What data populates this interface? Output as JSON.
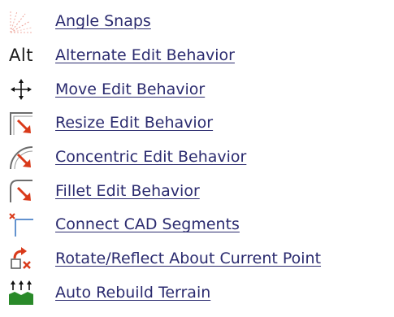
{
  "colors": {
    "link": "#2b2b6f",
    "accent_red": "#d93a1a",
    "accent_blue": "#2f6fbf",
    "icon_gray": "#6d6d6d",
    "icon_green": "#2a8a2a"
  },
  "items": [
    {
      "icon": "angle-snaps-icon",
      "label": "Angle Snaps"
    },
    {
      "icon": "alternate-edit-icon",
      "icon_text": "Alt",
      "label": "Alternate Edit Behavior"
    },
    {
      "icon": "move-edit-icon",
      "label": "Move Edit Behavior"
    },
    {
      "icon": "resize-edit-icon",
      "label": "Resize Edit Behavior"
    },
    {
      "icon": "concentric-edit-icon",
      "label": "Concentric Edit Behavior"
    },
    {
      "icon": "fillet-edit-icon",
      "label": "Fillet Edit Behavior"
    },
    {
      "icon": "connect-cad-segments-icon",
      "label": "Connect CAD Segments"
    },
    {
      "icon": "rotate-reflect-icon",
      "label": "Rotate/Reflect About Current Point"
    },
    {
      "icon": "auto-rebuild-terrain-icon",
      "label": "Auto Rebuild Terrain"
    }
  ]
}
